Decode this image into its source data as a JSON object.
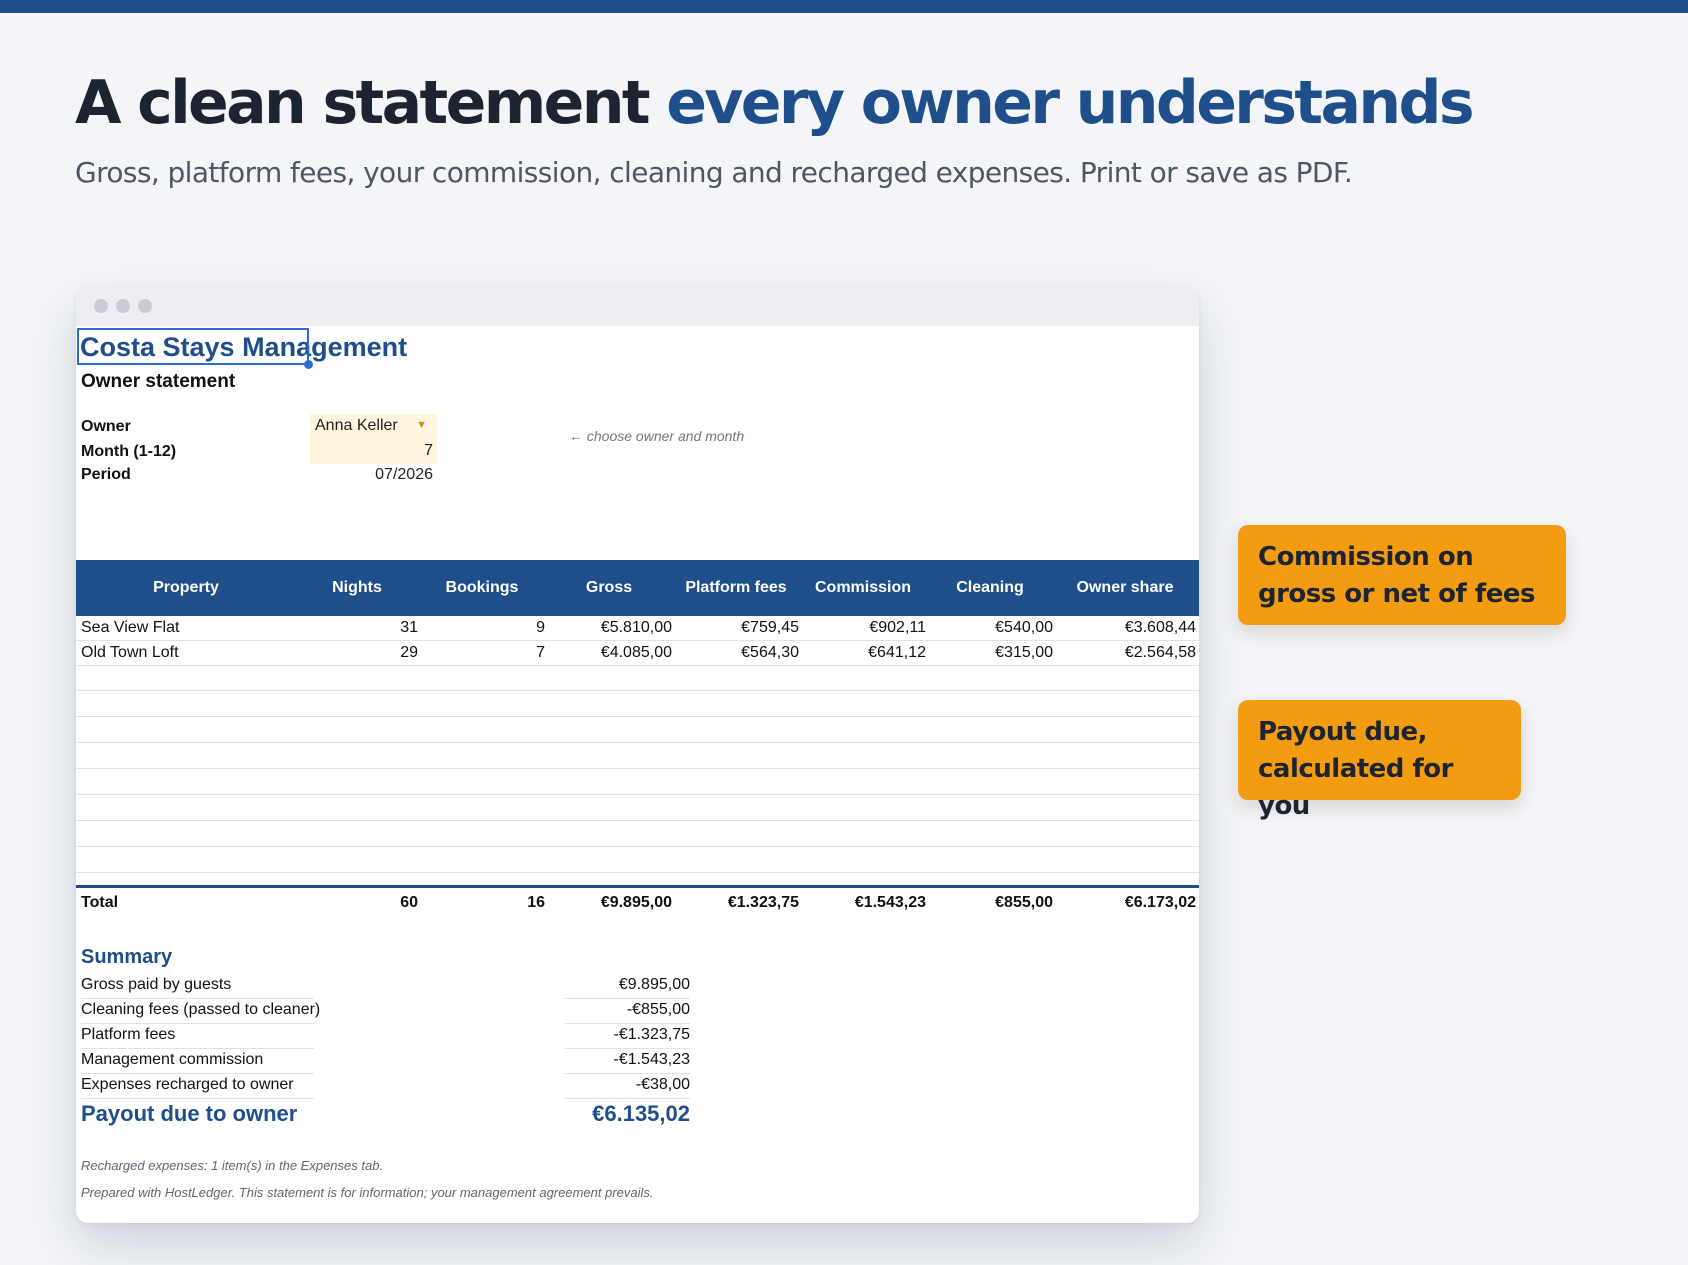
{
  "hero": {
    "title_main": "A clean statement ",
    "title_accent": "every owner understands",
    "subtitle": "Gross, platform fees, your commission, cleaning and recharged expenses. Print or save as PDF."
  },
  "sheet": {
    "company": "Costa Stays Management",
    "doc_title": "Owner statement",
    "fields": {
      "owner_label": "Owner",
      "owner_value": "Anna Keller",
      "month_label": "Month (1-12)",
      "month_value": "7",
      "period_label": "Period",
      "period_value": "07/2026"
    },
    "hint": "← choose owner and month",
    "table": {
      "headers": [
        "Property",
        "Nights",
        "Bookings",
        "Gross",
        "Platform fees",
        "Commission",
        "Cleaning",
        "Owner share"
      ],
      "rows": [
        [
          "Sea View Flat",
          "31",
          "9",
          "€5.810,00",
          "€759,45",
          "€902,11",
          "€540,00",
          "€3.608,44"
        ],
        [
          "Old Town Loft",
          "29",
          "7",
          "€4.085,00",
          "€564,30",
          "€641,12",
          "€315,00",
          "€2.564,58"
        ]
      ],
      "total": [
        "Total",
        "60",
        "16",
        "€9.895,00",
        "€1.323,75",
        "€1.543,23",
        "€855,00",
        "€6.173,02"
      ]
    },
    "summary": {
      "heading": "Summary",
      "items": [
        {
          "label": "Gross paid by guests",
          "value": "€9.895,00"
        },
        {
          "label": "Cleaning fees (passed to cleaner)",
          "value": "-€855,00"
        },
        {
          "label": "Platform fees",
          "value": "-€1.323,75"
        },
        {
          "label": "Management commission",
          "value": "-€1.543,23"
        },
        {
          "label": "Expenses recharged to owner",
          "value": "-€38,00"
        }
      ],
      "payout_label": "Payout due to owner",
      "payout_value": "€6.135,02"
    },
    "notes": [
      "Recharged expenses: 1 item(s) in the Expenses tab.",
      "Prepared with HostLedger. This statement is for information; your management agreement prevails."
    ]
  },
  "callouts": [
    {
      "text": "Commission on gross or net of fees"
    },
    {
      "text": "Payout due, calculated for you"
    }
  ],
  "colors": {
    "brand": "#1f4f8b",
    "callout": "#f39c11",
    "input_fill": "#fdf5dd",
    "background": "#f3f5f8"
  }
}
